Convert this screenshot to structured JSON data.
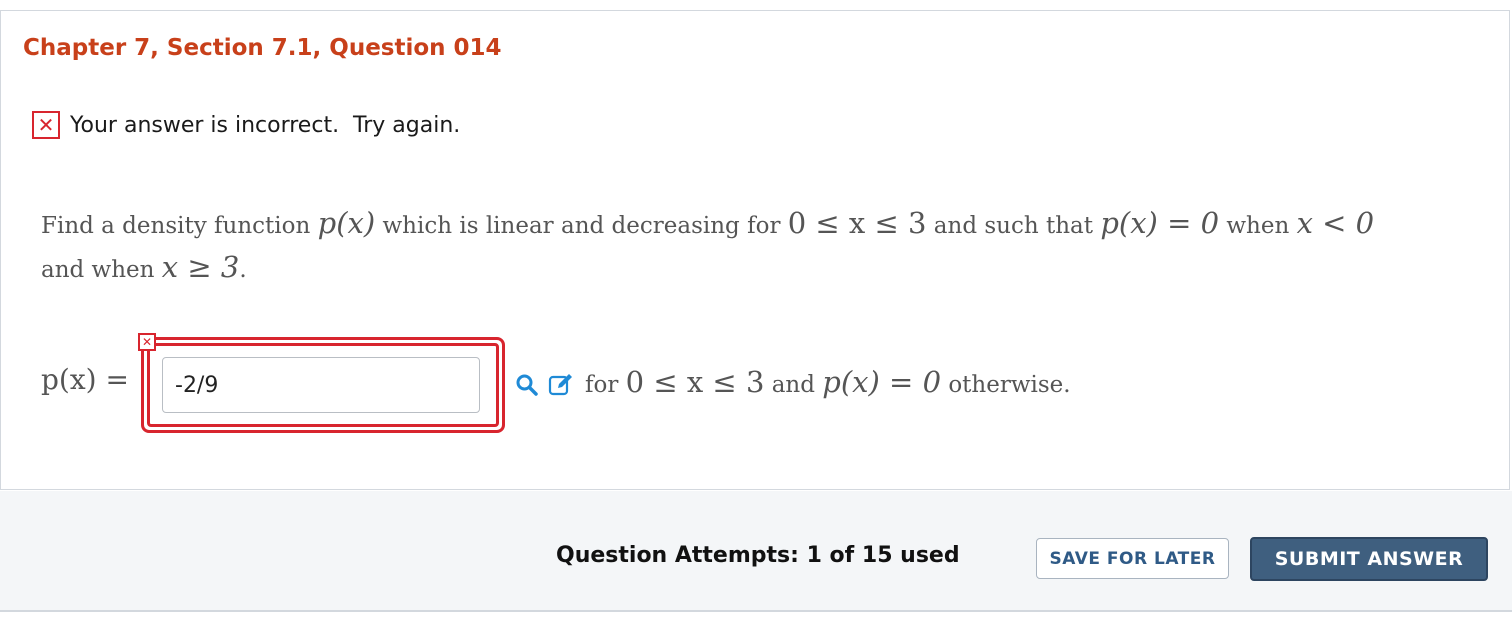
{
  "question": {
    "title": "Chapter 7, Section 7.1, Question 014"
  },
  "feedback": {
    "icon": "x-icon",
    "icon_glyph": "✕",
    "text": "Your answer is incorrect.  Try again."
  },
  "problem": {
    "t1": "Find a density function ",
    "m1": "p(x)",
    "t2": " which is linear and decreasing for ",
    "m2": "0 ≤ x ≤ 3",
    "t3": " and such that ",
    "m3": "p(x) = 0",
    "t4": " when ",
    "m4": "x < 0",
    "t5": "and when ",
    "m5": "x ≥ 3",
    "t6": "."
  },
  "answer": {
    "label": "p(x) =",
    "value": "-2/9",
    "status": "incorrect",
    "marker_glyph": "✕",
    "t1": "for ",
    "m1": "0 ≤ x ≤ 3",
    "t2": " and ",
    "m2": "p(x) = 0",
    "t3": " otherwise.",
    "tools": [
      "magnify-icon",
      "edit-icon"
    ]
  },
  "footer": {
    "attempts": "Question Attempts: 1 of 15 used",
    "save_label": "SAVE FOR LATER",
    "submit_label": "SUBMIT ANSWER"
  },
  "colors": {
    "title": "#c8401a",
    "error": "#d8252e",
    "tool_icon": "#1f8ad6",
    "submit_bg": "#3f5f7f",
    "save_text": "#2f5a86"
  }
}
